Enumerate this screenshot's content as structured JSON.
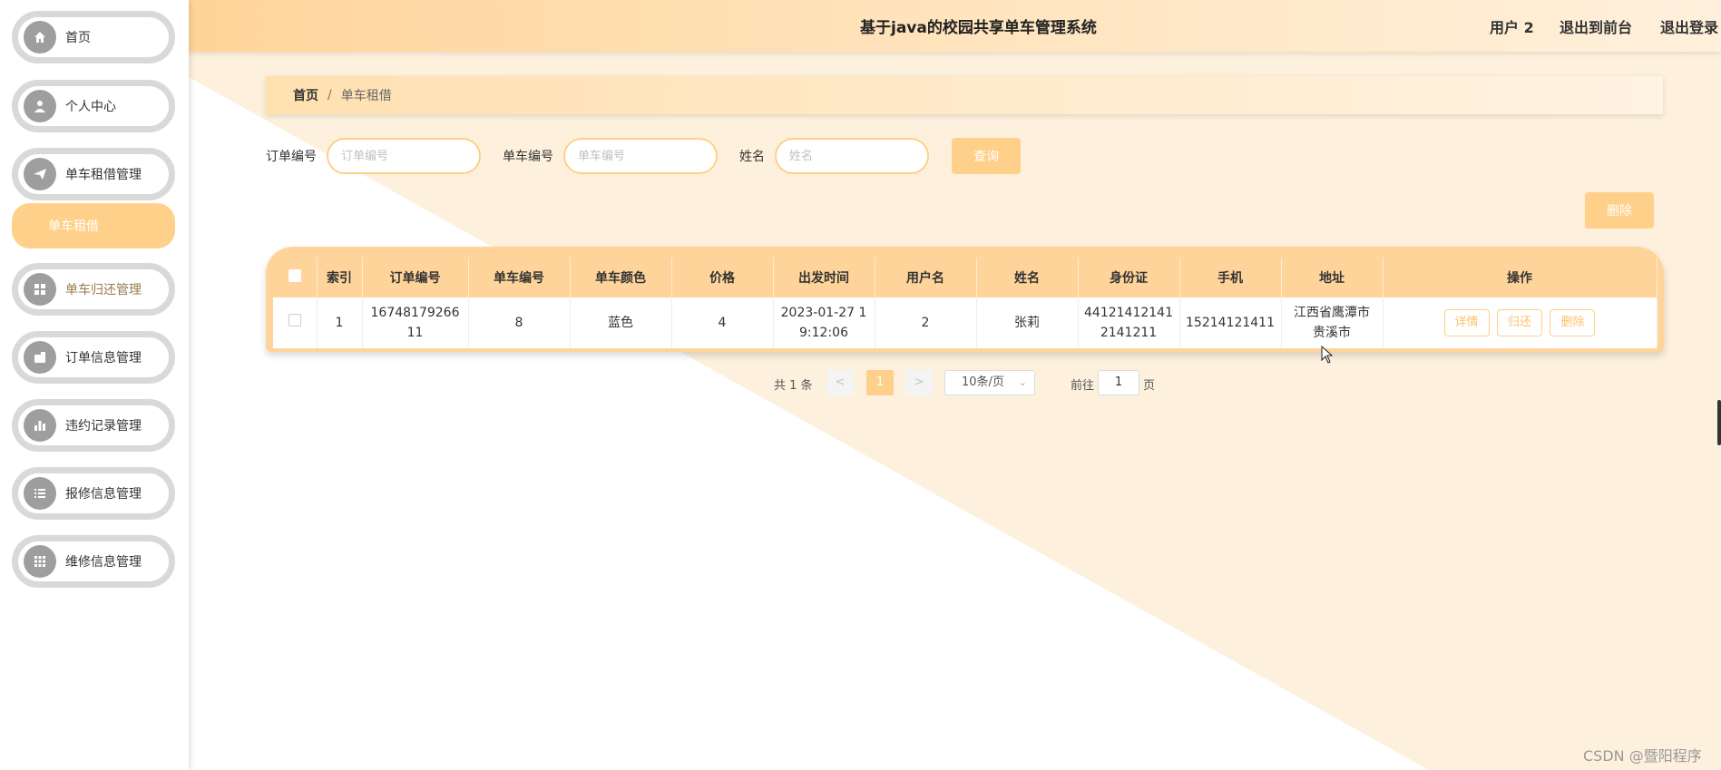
{
  "sidebar": {
    "items": [
      {
        "label": "首页",
        "icon": "home-icon"
      },
      {
        "label": "个人中心",
        "icon": "user-icon"
      },
      {
        "label": "单车租借管理",
        "icon": "paper-plane-icon"
      },
      {
        "label": "单车归还管理",
        "icon": "grid-icon"
      },
      {
        "label": "订单信息管理",
        "icon": "wallet-icon"
      },
      {
        "label": "违约记录管理",
        "icon": "bar-chart-icon"
      },
      {
        "label": "报修信息管理",
        "icon": "list-icon"
      },
      {
        "label": "维修信息管理",
        "icon": "apps-icon"
      }
    ],
    "submenu_label": "单车租借"
  },
  "header": {
    "title": "基于java的校园共享单车管理系统",
    "user": "用户 2",
    "to_front": "退出到前台",
    "logout": "退出登录"
  },
  "breadcrumb": {
    "home": "首页",
    "separator": "/",
    "current": "单车租借"
  },
  "search": {
    "order_label": "订单编号",
    "order_placeholder": "订单编号",
    "bike_label": "单车编号",
    "bike_placeholder": "单车编号",
    "name_label": "姓名",
    "name_placeholder": "姓名",
    "query_button": "查询"
  },
  "delete_button": "删除",
  "table": {
    "headers": [
      "索引",
      "订单编号",
      "单车编号",
      "单车颜色",
      "价格",
      "出发时间",
      "用户名",
      "姓名",
      "身份证",
      "手机",
      "地址",
      "操作"
    ],
    "rows": [
      {
        "index": "1",
        "order_no_l1": "16748179266",
        "order_no_l2": "11",
        "bike_no": "8",
        "color": "蓝色",
        "price": "4",
        "time_l1": "2023-01-27 1",
        "time_l2": "9:12:06",
        "username": "2",
        "name": "张莉",
        "id_l1": "44121412141",
        "id_l2": "2141211",
        "phone": "15214121411",
        "addr_l1": "江西省鹰潭市",
        "addr_l2": "贵溪市",
        "actions": {
          "detail": "详情",
          "return": "归还",
          "delete": "删除"
        }
      }
    ]
  },
  "pagination": {
    "total": "共 1 条",
    "prev": "<",
    "page": "1",
    "next": ">",
    "page_size": "10条/页",
    "goto_label": "前往",
    "goto_value": "1",
    "page_unit": "页"
  },
  "watermark": "CSDN @暨阳程序",
  "colors": {
    "accent": "#ffd08a",
    "header_start": "#ffd49a",
    "bg_tint": "#fdf0dc"
  }
}
